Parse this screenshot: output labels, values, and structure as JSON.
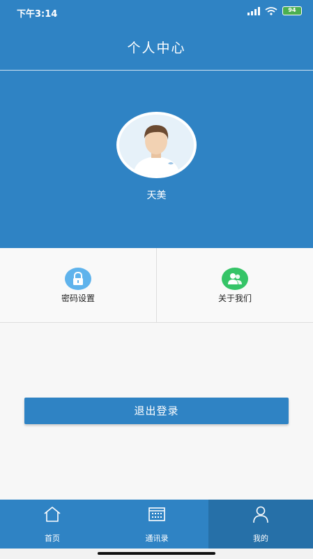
{
  "status_bar": {
    "time": "下午3:14",
    "battery": "94"
  },
  "header": {
    "title": "个人中心"
  },
  "profile": {
    "username": "天美"
  },
  "menu": [
    {
      "label": "密码设置",
      "icon": "lock-icon",
      "color": "#5fb3ec"
    },
    {
      "label": "关于我们",
      "icon": "users-icon",
      "color": "#35c467"
    }
  ],
  "logout": {
    "label": "退出登录"
  },
  "tabs": [
    {
      "label": "首页",
      "icon": "home-icon"
    },
    {
      "label": "通讯录",
      "icon": "contacts-icon"
    },
    {
      "label": "我的",
      "icon": "user-icon",
      "active": true
    }
  ],
  "colors": {
    "primary": "#2f83c4",
    "active_tab": "#2670a8"
  }
}
